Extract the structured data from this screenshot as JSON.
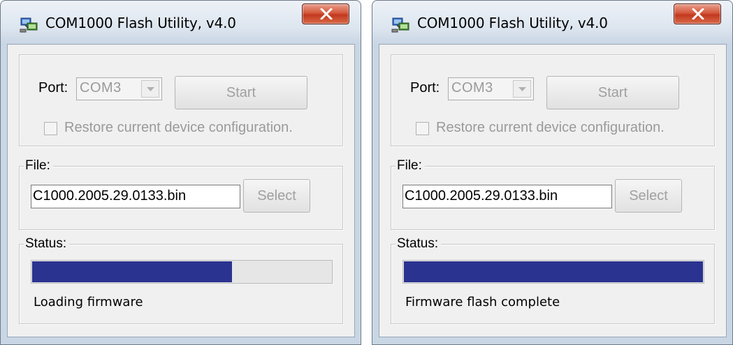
{
  "colors": {
    "progress_fill": "#2b3390",
    "close_button": "#c2391f",
    "disabled_text": "#9a9a9a"
  },
  "windows": [
    {
      "title": "COM1000 Flash Utility, v4.0",
      "icon": "flash-utility-app-icon",
      "port": {
        "label": "Port:",
        "selected": "COM3",
        "start_label": "Start",
        "restore_label": "Restore current device configuration.",
        "restore_checked": false
      },
      "file": {
        "legend": "File:",
        "value": "C1000.2005.29.0133.bin",
        "select_label": "Select"
      },
      "status": {
        "legend": "Status:",
        "progress_percent": 67,
        "text": "Loading firmware"
      }
    },
    {
      "title": "COM1000 Flash Utility, v4.0",
      "icon": "flash-utility-app-icon",
      "port": {
        "label": "Port:",
        "selected": "COM3",
        "start_label": "Start",
        "restore_label": "Restore current device configuration.",
        "restore_checked": false
      },
      "file": {
        "legend": "File:",
        "value": "C1000.2005.29.0133.bin",
        "select_label": "Select"
      },
      "status": {
        "legend": "Status:",
        "progress_percent": 100,
        "text": "Firmware flash complete"
      }
    }
  ]
}
